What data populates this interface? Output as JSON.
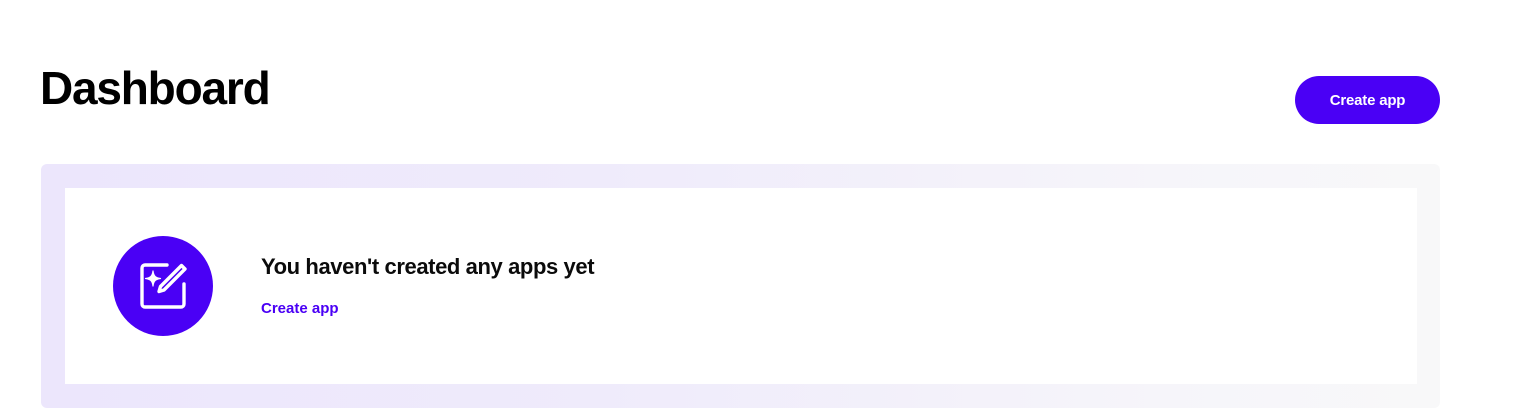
{
  "header": {
    "title": "Dashboard",
    "create_button_label": "Create app"
  },
  "empty_state": {
    "heading": "You haven't created any apps yet",
    "link_label": "Create app",
    "icon": "edit-sparkle-icon"
  },
  "colors": {
    "accent": "#4a00f5",
    "panel_tint": "#ece6fc",
    "text": "#0b0b0b"
  }
}
